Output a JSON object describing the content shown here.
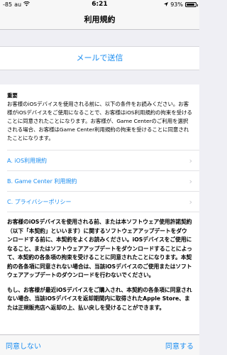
{
  "status": {
    "signal": "-85",
    "carrier": "au",
    "time": "6:21",
    "battery": "93%",
    "battery_level": 0.93
  },
  "nav": {
    "title": "利用規約"
  },
  "email": {
    "label": "メールで送信"
  },
  "important": {
    "heading": "重要",
    "body": "お客様のiOSデバイスを使用される前に、以下の条件をお読みください。お客様がiOSデバイスをご使用になることで、お客様はiOS利用規約の拘束を受けることに同意されたことになります。お客様が、Game Centerのご利用を選択される場合、お客様はGame Center利用規約の拘束を受けることに同意されたことになります。"
  },
  "links": [
    {
      "label": "A. iOS利用規約"
    },
    {
      "label": "B. Game Center 利用規約"
    },
    {
      "label": "C. プライバシーポリシー"
    }
  ],
  "paragraph1": "お客様のiOSデバイスを使用される前、または本ソフトウェア使用許諾契約（以下「本契約」といいます）に関するソフトウェアアップデートをダウンロードする前に、本契約をよくお読みください。iOSデバイスをご使用になること、またはソフトウェアアップデートをダウンロードすることによって、本契約の各条項の拘束を受けることに同意されたことになります。本契約の各条項に同意されない場合は、当該iOSデバイスのご使用またはソフトウェアアップデートのダウンロードを行わないでください。",
  "paragraph2": "もし、お客様が最近iOSデバイスをご購入され、本契約の各条項に同意されない場合、当該iOSデバイスを返却期間内に取得されたApple Store、または正規販売店へ返却の上、払い戻しを受けることができます。",
  "toolbar": {
    "disagree": "同意しない",
    "agree": "同意する"
  }
}
